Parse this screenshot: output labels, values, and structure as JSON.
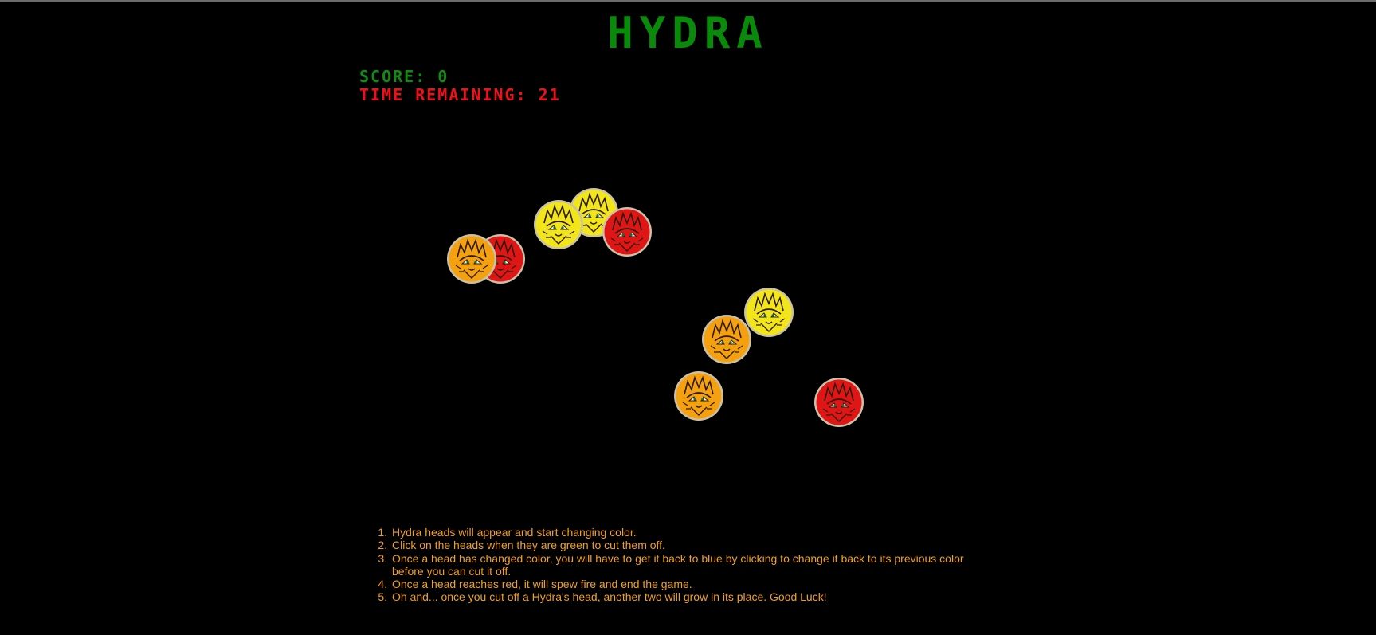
{
  "title": "HYDRA",
  "score": {
    "label": "SCORE:",
    "value": "0"
  },
  "time": {
    "label": "TIME REMAINING:",
    "value": "21"
  },
  "colors": {
    "yellow": "#f2e51a",
    "orange": "#f5a00f",
    "red": "#e01515",
    "title_green": "#0a8a0a",
    "time_red": "#f0101a",
    "text_orange": "#f0a020"
  },
  "heads": [
    {
      "color": "orange",
      "icon": "hydra-head-icon"
    },
    {
      "color": "red",
      "icon": "hydra-head-icon"
    },
    {
      "color": "yellow",
      "icon": "hydra-head-icon"
    },
    {
      "color": "yellow",
      "icon": "hydra-head-icon"
    },
    {
      "color": "red",
      "icon": "hydra-head-icon"
    },
    {
      "color": "yellow",
      "icon": "hydra-head-icon"
    },
    {
      "color": "orange",
      "icon": "hydra-head-icon"
    },
    {
      "color": "orange",
      "icon": "hydra-head-icon"
    },
    {
      "color": "red",
      "icon": "hydra-head-icon"
    }
  ],
  "instructions": [
    "Hydra heads will appear and start changing color.",
    "Click on the heads when they are green to cut them off.",
    "Once a head has changed color, you will have to get it back to blue by clicking to change it back to its previous color before you can cut it off.",
    "Once a head reaches red, it will spew fire and end the game.",
    "Oh and... once you cut off a Hydra's head, another two will grow in its place. Good Luck!"
  ]
}
